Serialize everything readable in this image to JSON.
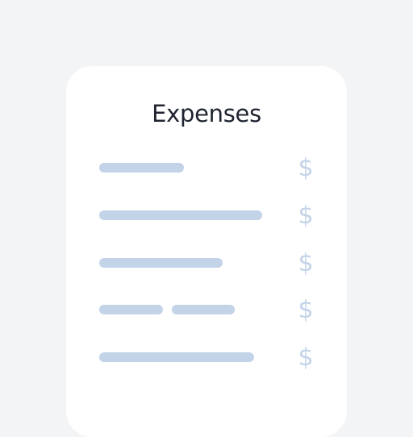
{
  "card": {
    "title": "Expenses",
    "rows": [
      {
        "bars": 1,
        "currency_icon": "$"
      },
      {
        "bars": 1,
        "currency_icon": "$"
      },
      {
        "bars": 1,
        "currency_icon": "$"
      },
      {
        "bars": 2,
        "currency_icon": "$"
      },
      {
        "bars": 1,
        "currency_icon": "$"
      }
    ]
  },
  "colors": {
    "background": "#f3f4f6",
    "card": "#ffffff",
    "placeholder": "#c3d3e8",
    "title": "#1f2430"
  }
}
